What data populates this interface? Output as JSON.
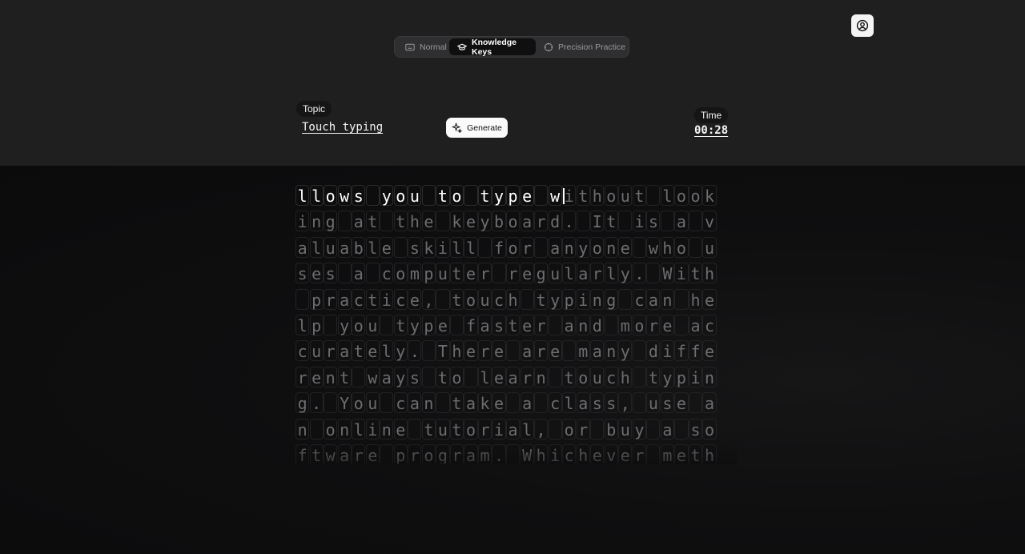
{
  "modes": [
    {
      "label": "Normal",
      "icon": "keyboard-icon",
      "active": false
    },
    {
      "label": "Knowledge Keys",
      "icon": "graduation-cap-icon",
      "active": true
    },
    {
      "label": "Precision Practice",
      "icon": "crosshair-icon",
      "active": false
    }
  ],
  "topic": {
    "label": "Topic",
    "value": "Touch typing"
  },
  "generate": {
    "label": "Generate",
    "icon": "sparkles-icon"
  },
  "time": {
    "label": "Time",
    "value": "00:28"
  },
  "typing": {
    "typed_count": 19,
    "lines": [
      "llows you to type without look",
      "ing at the keyboard. It is a v",
      "aluable skill for anyone who u",
      "ses a computer regularly. With",
      " practice, touch typing can he",
      "lp you type faster and more ac",
      "curately. There are many diffe",
      "rent ways to learn touch typin",
      "g. You can take a class, use a",
      "n online tutorial, or buy a so",
      "ftware program. Whichever meth"
    ]
  },
  "colors": {
    "accent": "#ffffff",
    "background_top": "#1f1f20",
    "background_bottom": "#0c0c0d",
    "untyped_text": "#6d6d70"
  },
  "icons": {
    "profile": "user-circle-icon"
  }
}
